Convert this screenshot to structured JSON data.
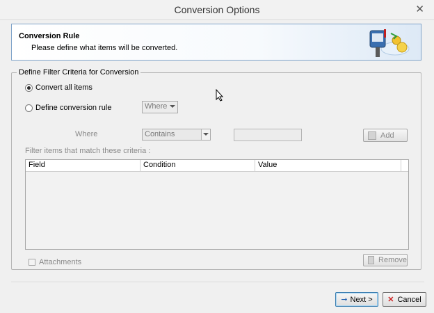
{
  "window": {
    "title": "Conversion Options",
    "close_glyph": "✕"
  },
  "header": {
    "title": "Conversion Rule",
    "subtitle": "Please define what items will be converted."
  },
  "filter": {
    "legend": "Define Filter Criteria for Conversion",
    "convert_all_label": "Convert all items",
    "define_rule_label": "Define conversion rule",
    "where_combo_value": "Where",
    "where_label": "Where",
    "condition_combo_value": "Contains",
    "add_label": "Add",
    "criteria_label": "Filter items that match these criteria :",
    "columns": [
      "Field",
      "Condition",
      "Value"
    ],
    "attachments_label": "Attachments",
    "remove_label": "Remove"
  },
  "footer": {
    "next_label": "Next >",
    "cancel_label": "Cancel",
    "next_arrow": "➞",
    "cancel_x": "✕"
  },
  "colors": {
    "accent_red": "#cc1f1f",
    "accent_blue": "#1f5fb0",
    "header_border": "#7fa3c9"
  }
}
